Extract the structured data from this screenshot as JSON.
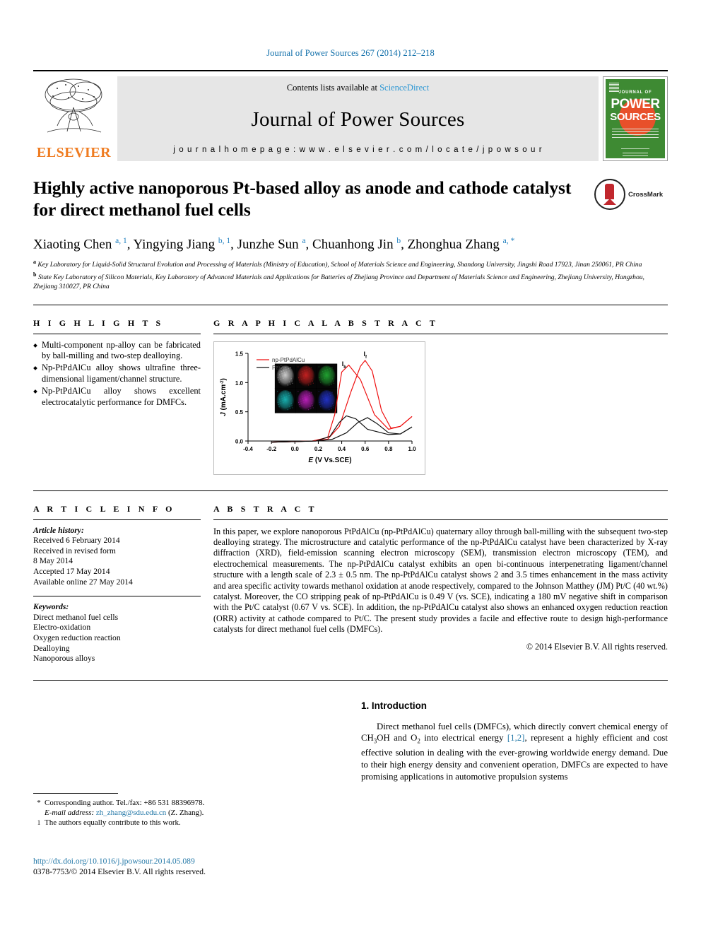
{
  "running_head": "Journal of Power Sources 267 (2014) 212–218",
  "journal_header": {
    "contents_prefix": "Contents lists available at ",
    "sciencedirect": "ScienceDirect",
    "journal_name": "Journal of Power Sources",
    "homepage": "j o u r n a l   h o m e p a g e :   w w w . e l s e v i e r . c o m / l o c a t e / j p o w s o u r",
    "publisher": "ELSEVIER",
    "cover": {
      "line1": "JOURNAL OF",
      "line2": "POWER",
      "line3": "SOURCES"
    }
  },
  "article": {
    "title": "Highly active nanoporous Pt-based alloy as anode and cathode catalyst for direct methanol fuel cells",
    "crossmark_label": "CrossMark",
    "authors_html": "Xiaoting Chen <sup>a, 1</sup>, Yingying Jiang <sup>b, 1</sup>, Junzhe Sun <sup>a</sup>, Chuanhong Jin <sup>b</sup>, Zhonghua Zhang <sup>a, *</sup>",
    "affiliations": [
      "a Key Laboratory for Liquid-Solid Structural Evolution and Processing of Materials (Ministry of Education), School of Materials Science and Engineering, Shandong University, Jingshi Road 17923, Jinan 250061, PR China",
      "b State Key Laboratory of Silicon Materials, Key Laboratory of Advanced Materials and Applications for Batteries of Zhejiang Province and Department of Materials Science and Engineering, Zhejiang University, Hangzhou, Zhejiang 310027, PR China"
    ]
  },
  "highlights": {
    "heading": "H I G H L I G H T S",
    "items": [
      "Multi-component np-alloy can be fabricated by ball-milling and two-step dealloying.",
      "Np-PtPdAlCu alloy shows ultrafine three-dimensional ligament/channel structure.",
      "Np-PtPdAlCu alloy shows excellent electrocatalytic performance for DMFCs."
    ]
  },
  "graphical_abstract": {
    "heading": "G R A P H I C A L   A B S T R A C T"
  },
  "chart_data": {
    "type": "line",
    "title": "",
    "xlabel": "E (V Vs.SCE)",
    "ylabel": "J (mA.cm⁻²)",
    "xlim": [
      -0.4,
      1.0
    ],
    "ylim": [
      0.0,
      1.5
    ],
    "xticks": [
      -0.4,
      -0.2,
      0.0,
      0.2,
      0.4,
      0.6,
      0.8,
      1.0
    ],
    "yticks": [
      0.0,
      0.5,
      1.0,
      1.5
    ],
    "grid": false,
    "legend_position": "top-left",
    "annotations": [
      {
        "text": "I",
        "sub": "b",
        "x": 0.42,
        "y": 1.28
      },
      {
        "text": "I",
        "sub": "f",
        "x": 0.6,
        "y": 1.45
      }
    ],
    "series": [
      {
        "name": "np-PtPdAlCu",
        "color": "#ee1111",
        "forward_peak": {
          "x": 0.6,
          "y": 1.38
        },
        "backward_peak": {
          "x": 0.44,
          "y": 1.3
        },
        "points_forward": [
          [
            -0.2,
            -0.02
          ],
          [
            0.0,
            -0.01
          ],
          [
            0.15,
            0.0
          ],
          [
            0.28,
            0.03
          ],
          [
            0.38,
            0.25
          ],
          [
            0.48,
            0.85
          ],
          [
            0.56,
            1.28
          ],
          [
            0.6,
            1.38
          ],
          [
            0.66,
            1.2
          ],
          [
            0.74,
            0.52
          ],
          [
            0.82,
            0.22
          ],
          [
            0.9,
            0.25
          ],
          [
            1.0,
            0.42
          ]
        ],
        "points_backward": [
          [
            1.0,
            0.42
          ],
          [
            0.9,
            0.25
          ],
          [
            0.8,
            0.2
          ],
          [
            0.68,
            0.45
          ],
          [
            0.56,
            1.05
          ],
          [
            0.46,
            1.3
          ],
          [
            0.4,
            1.18
          ],
          [
            0.34,
            0.45
          ],
          [
            0.28,
            0.06
          ],
          [
            0.15,
            0.0
          ],
          [
            0.0,
            -0.01
          ],
          [
            -0.2,
            -0.02
          ]
        ]
      },
      {
        "name": "Pt/C",
        "color": "#111111",
        "forward_peak": {
          "x": 0.62,
          "y": 0.4
        },
        "backward_peak": {
          "x": 0.44,
          "y": 0.43
        },
        "points_forward": [
          [
            -0.2,
            -0.02
          ],
          [
            0.0,
            -0.01
          ],
          [
            0.18,
            0.0
          ],
          [
            0.32,
            0.03
          ],
          [
            0.44,
            0.14
          ],
          [
            0.54,
            0.32
          ],
          [
            0.62,
            0.4
          ],
          [
            0.7,
            0.3
          ],
          [
            0.8,
            0.14
          ],
          [
            0.9,
            0.12
          ],
          [
            1.0,
            0.24
          ]
        ],
        "points_backward": [
          [
            1.0,
            0.24
          ],
          [
            0.9,
            0.12
          ],
          [
            0.8,
            0.11
          ],
          [
            0.62,
            0.2
          ],
          [
            0.52,
            0.38
          ],
          [
            0.44,
            0.43
          ],
          [
            0.38,
            0.32
          ],
          [
            0.3,
            0.08
          ],
          [
            0.18,
            0.0
          ],
          [
            0.0,
            -0.01
          ],
          [
            -0.2,
            -0.02
          ]
        ]
      }
    ],
    "inset": {
      "description": "STEM image and EDS elemental maps montage",
      "panel_colors": [
        "#d6d6d6",
        "#cc2222",
        "#22aa33",
        "#19b8b8",
        "#c020c0",
        "#2233cc"
      ]
    }
  },
  "article_info": {
    "heading": "A R T I C L E   I N F O",
    "history_label": "Article history:",
    "history": [
      "Received 6 February 2014",
      "Received in revised form",
      "8 May 2014",
      "Accepted 17 May 2014",
      "Available online 27 May 2014"
    ],
    "keywords_label": "Keywords:",
    "keywords": [
      "Direct methanol fuel cells",
      "Electro-oxidation",
      "Oxygen reduction reaction",
      "Dealloying",
      "Nanoporous alloys"
    ]
  },
  "abstract": {
    "heading": "A B S T R A C T",
    "text": "In this paper, we explore nanoporous PtPdAlCu (np-PtPdAlCu) quaternary alloy through ball-milling with the subsequent two-step dealloying strategy. The microstructure and catalytic performance of the np-PtPdAlCu catalyst have been characterized by X-ray diffraction (XRD), field-emission scanning electron microscopy (SEM), transmission electron microscopy (TEM), and electrochemical measurements. The np-PtPdAlCu catalyst exhibits an open bi-continuous interpenetrating ligament/channel structure with a length scale of 2.3 ± 0.5 nm. The np-PtPdAlCu catalyst shows 2 and 3.5 times enhancement in the mass activity and area specific activity towards methanol oxidation at anode respectively, compared to the Johnson Matthey (JM) Pt/C (40 wt.%) catalyst. Moreover, the CO stripping peak of np-PtPdAlCu is 0.49 V (vs. SCE), indicating a 180 mV negative shift in comparison with the Pt/C catalyst (0.67 V vs. SCE). In addition, the np-PtPdAlCu catalyst also shows an enhanced oxygen reduction reaction (ORR) activity at cathode compared to Pt/C. The present study provides a facile and effective route to design high-performance catalysts for direct methanol fuel cells (DMFCs).",
    "copyright": "© 2014 Elsevier B.V. All rights reserved."
  },
  "introduction": {
    "heading": "1.  Introduction",
    "paragraph_pre": "Direct methanol fuel cells (DMFCs), which directly convert chemical energy of CH",
    "sub1": "3",
    "paragraph_mid1": "OH and O",
    "sub2": "2",
    "paragraph_mid2": " into electrical energy ",
    "ref": "[1,2]",
    "paragraph_post": ", represent a highly efficient and cost effective solution in dealing with the ever-growing worldwide energy demand. Due to their high energy density and convenient operation, DMFCs are expected to have promising applications in automotive propulsion systems"
  },
  "footnotes": {
    "corresponding_mark": "*",
    "corresponding_text": "Corresponding author. Tel./fax: +86 531 88396978.",
    "email_label": "E-mail address:",
    "email": "zh_zhang@sdu.edu.cn",
    "email_suffix": "(Z. Zhang).",
    "equal_mark": "1",
    "equal_text": "The authors equally contribute to this work."
  },
  "doi_block": {
    "doi": "http://dx.doi.org/10.1016/j.jpowsour.2014.05.089",
    "issn_line": "0378-7753/© 2014 Elsevier B.V. All rights reserved."
  }
}
